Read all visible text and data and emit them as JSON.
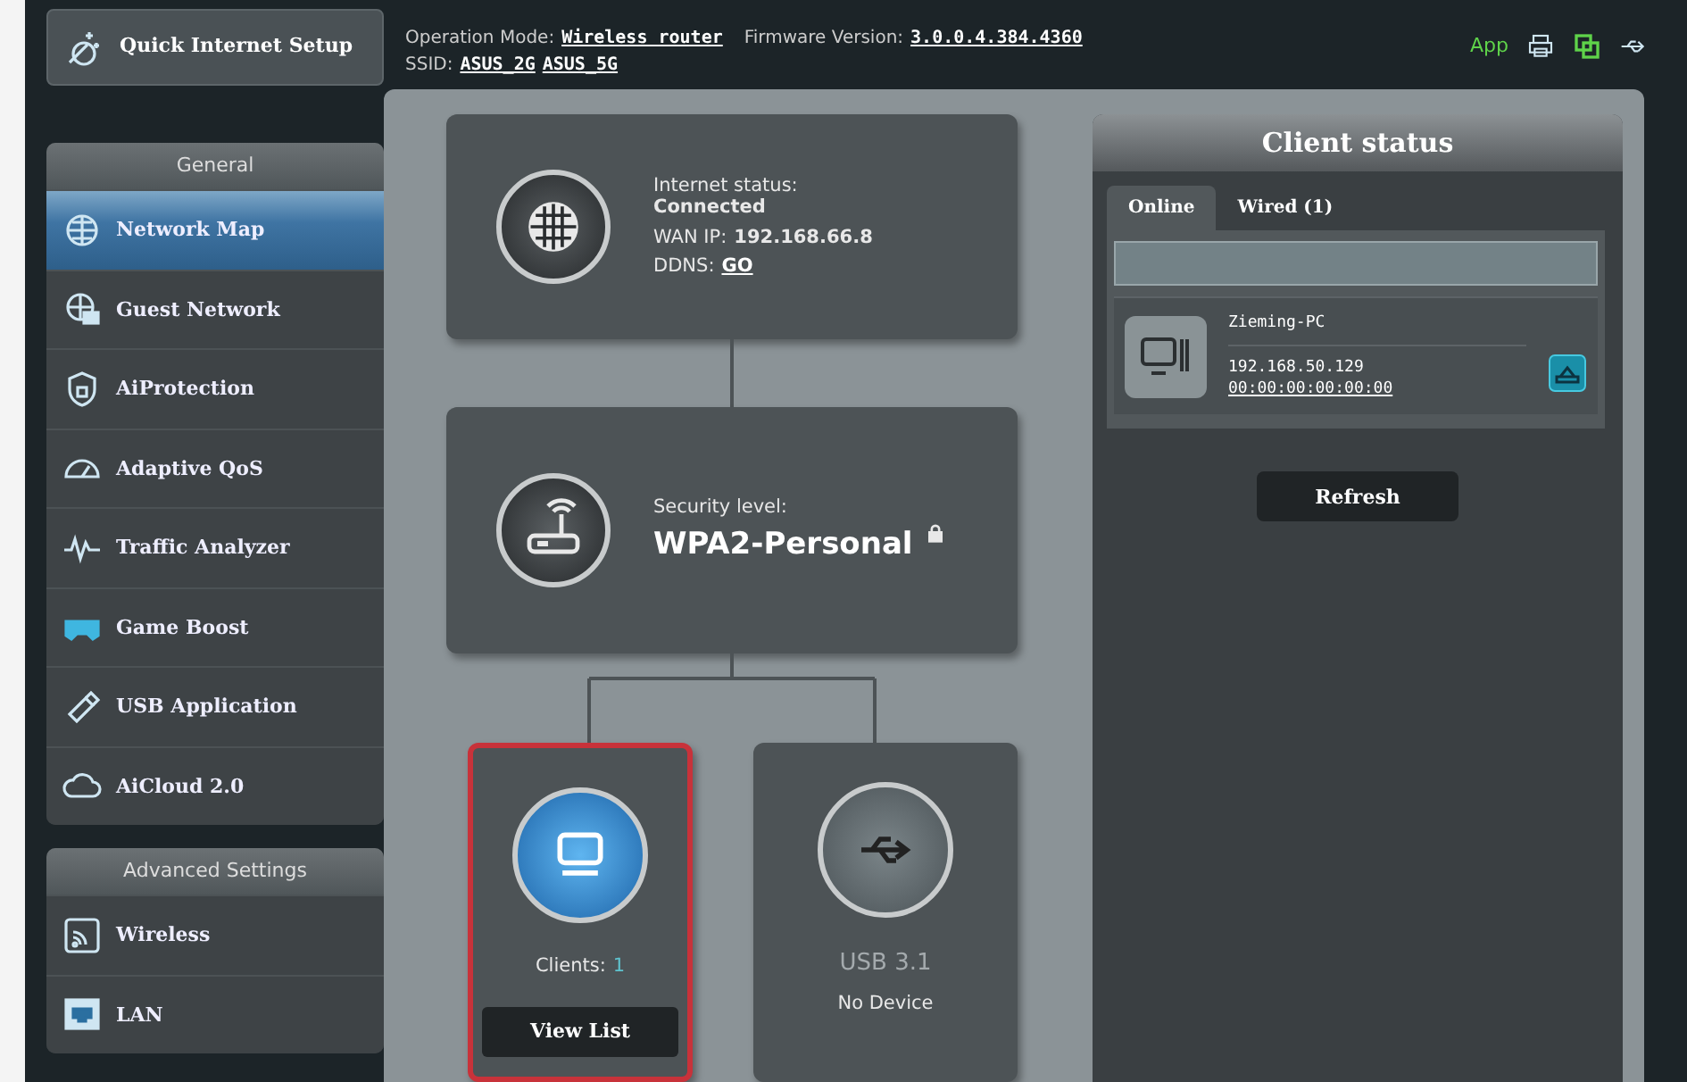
{
  "header": {
    "quick_setup": "Quick Internet Setup",
    "operation_mode_label": "Operation Mode:",
    "operation_mode": "Wireless router",
    "firmware_label": "Firmware Version:",
    "firmware": "3.0.0.4.384.4360",
    "ssid_label": "SSID:",
    "ssids": [
      "ASUS_2G",
      "ASUS_5G"
    ],
    "app_label": "App"
  },
  "sidebar": {
    "sections": [
      {
        "title": "General",
        "items": [
          {
            "label": "Network Map",
            "selected": true
          },
          {
            "label": "Guest Network",
            "selected": false
          },
          {
            "label": "AiProtection",
            "selected": false
          },
          {
            "label": "Adaptive QoS",
            "selected": false
          },
          {
            "label": "Traffic Analyzer",
            "selected": false
          },
          {
            "label": "Game Boost",
            "selected": false
          },
          {
            "label": "USB Application",
            "selected": false
          },
          {
            "label": "AiCloud 2.0",
            "selected": false
          }
        ]
      },
      {
        "title": "Advanced Settings",
        "items": [
          {
            "label": "Wireless",
            "selected": false
          },
          {
            "label": "LAN",
            "selected": false
          }
        ]
      }
    ]
  },
  "internet": {
    "status_label": "Internet status:",
    "status": "Connected",
    "wan_ip_label": "WAN IP:",
    "wan_ip": "192.168.66.8",
    "ddns_label": "DDNS:",
    "ddns": "GO"
  },
  "security": {
    "label": "Security level:",
    "value": "WPA2-Personal"
  },
  "clients_card": {
    "label": "Clients:",
    "count": "1",
    "button": "View List",
    "highlighted": true
  },
  "usb_card": {
    "label": "USB 3.1",
    "status": "No Device"
  },
  "client_status": {
    "title": "Client status",
    "tabs": [
      {
        "label": "Online",
        "selected": true
      },
      {
        "label": "Wired (1)",
        "selected": false
      }
    ],
    "clients": [
      {
        "name": "Zieming-PC",
        "ip": "192.168.50.129",
        "mac": "00:00:00:00:00:00"
      }
    ],
    "refresh": "Refresh"
  }
}
